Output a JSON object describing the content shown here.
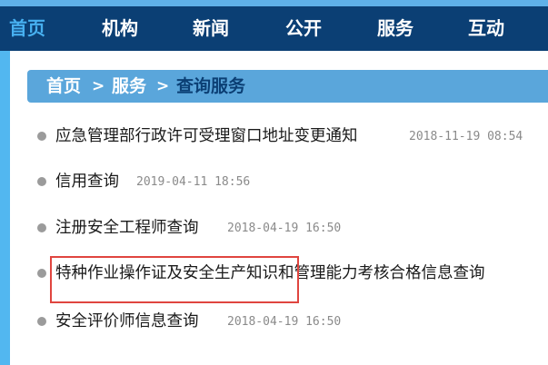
{
  "nav": {
    "items": [
      {
        "label": "首页",
        "active": true
      },
      {
        "label": "机构",
        "active": false
      },
      {
        "label": "新闻",
        "active": false
      },
      {
        "label": "公开",
        "active": false
      },
      {
        "label": "服务",
        "active": false
      },
      {
        "label": "互动",
        "active": false
      }
    ]
  },
  "breadcrumb": {
    "home": "首页",
    "separator": ">",
    "section": "服务",
    "current": "查询服务"
  },
  "list": {
    "items": [
      {
        "title": "应急管理部行政许可受理窗口地址变更通知",
        "date": "2018-11-19 08:54"
      },
      {
        "title": "信用查询",
        "date": "2019-04-11 18:56"
      },
      {
        "title": "注册安全工程师查询",
        "date": "2018-04-19 16:50"
      },
      {
        "title": "特种作业操作证及安全生产知识和管理能力考核合格信息查询",
        "date": ""
      },
      {
        "title": "安全评价师信息查询",
        "date": "2018-04-19 16:50"
      }
    ]
  },
  "colors": {
    "nav_bg": "#0b3f74",
    "nav_active": "#47b0f0",
    "breadcrumb_bg": "#5aa6db",
    "highlight_border": "#e0453f"
  }
}
